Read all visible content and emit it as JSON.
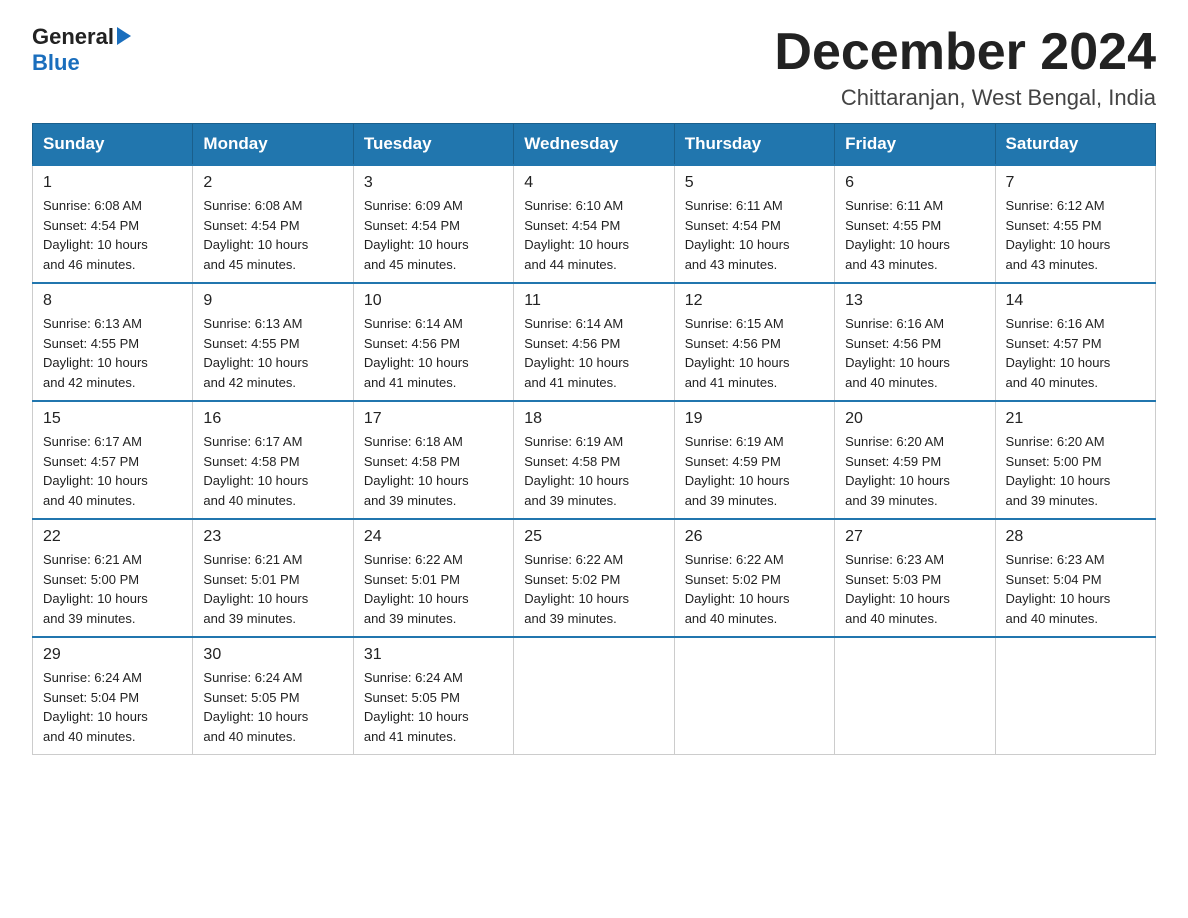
{
  "header": {
    "logo_general": "General",
    "logo_blue": "Blue",
    "title": "December 2024",
    "subtitle": "Chittaranjan, West Bengal, India"
  },
  "days_of_week": [
    "Sunday",
    "Monday",
    "Tuesday",
    "Wednesday",
    "Thursday",
    "Friday",
    "Saturday"
  ],
  "weeks": [
    [
      {
        "day": "1",
        "sunrise": "6:08 AM",
        "sunset": "4:54 PM",
        "daylight": "10 hours and 46 minutes."
      },
      {
        "day": "2",
        "sunrise": "6:08 AM",
        "sunset": "4:54 PM",
        "daylight": "10 hours and 45 minutes."
      },
      {
        "day": "3",
        "sunrise": "6:09 AM",
        "sunset": "4:54 PM",
        "daylight": "10 hours and 45 minutes."
      },
      {
        "day": "4",
        "sunrise": "6:10 AM",
        "sunset": "4:54 PM",
        "daylight": "10 hours and 44 minutes."
      },
      {
        "day": "5",
        "sunrise": "6:11 AM",
        "sunset": "4:54 PM",
        "daylight": "10 hours and 43 minutes."
      },
      {
        "day": "6",
        "sunrise": "6:11 AM",
        "sunset": "4:55 PM",
        "daylight": "10 hours and 43 minutes."
      },
      {
        "day": "7",
        "sunrise": "6:12 AM",
        "sunset": "4:55 PM",
        "daylight": "10 hours and 43 minutes."
      }
    ],
    [
      {
        "day": "8",
        "sunrise": "6:13 AM",
        "sunset": "4:55 PM",
        "daylight": "10 hours and 42 minutes."
      },
      {
        "day": "9",
        "sunrise": "6:13 AM",
        "sunset": "4:55 PM",
        "daylight": "10 hours and 42 minutes."
      },
      {
        "day": "10",
        "sunrise": "6:14 AM",
        "sunset": "4:56 PM",
        "daylight": "10 hours and 41 minutes."
      },
      {
        "day": "11",
        "sunrise": "6:14 AM",
        "sunset": "4:56 PM",
        "daylight": "10 hours and 41 minutes."
      },
      {
        "day": "12",
        "sunrise": "6:15 AM",
        "sunset": "4:56 PM",
        "daylight": "10 hours and 41 minutes."
      },
      {
        "day": "13",
        "sunrise": "6:16 AM",
        "sunset": "4:56 PM",
        "daylight": "10 hours and 40 minutes."
      },
      {
        "day": "14",
        "sunrise": "6:16 AM",
        "sunset": "4:57 PM",
        "daylight": "10 hours and 40 minutes."
      }
    ],
    [
      {
        "day": "15",
        "sunrise": "6:17 AM",
        "sunset": "4:57 PM",
        "daylight": "10 hours and 40 minutes."
      },
      {
        "day": "16",
        "sunrise": "6:17 AM",
        "sunset": "4:58 PM",
        "daylight": "10 hours and 40 minutes."
      },
      {
        "day": "17",
        "sunrise": "6:18 AM",
        "sunset": "4:58 PM",
        "daylight": "10 hours and 39 minutes."
      },
      {
        "day": "18",
        "sunrise": "6:19 AM",
        "sunset": "4:58 PM",
        "daylight": "10 hours and 39 minutes."
      },
      {
        "day": "19",
        "sunrise": "6:19 AM",
        "sunset": "4:59 PM",
        "daylight": "10 hours and 39 minutes."
      },
      {
        "day": "20",
        "sunrise": "6:20 AM",
        "sunset": "4:59 PM",
        "daylight": "10 hours and 39 minutes."
      },
      {
        "day": "21",
        "sunrise": "6:20 AM",
        "sunset": "5:00 PM",
        "daylight": "10 hours and 39 minutes."
      }
    ],
    [
      {
        "day": "22",
        "sunrise": "6:21 AM",
        "sunset": "5:00 PM",
        "daylight": "10 hours and 39 minutes."
      },
      {
        "day": "23",
        "sunrise": "6:21 AM",
        "sunset": "5:01 PM",
        "daylight": "10 hours and 39 minutes."
      },
      {
        "day": "24",
        "sunrise": "6:22 AM",
        "sunset": "5:01 PM",
        "daylight": "10 hours and 39 minutes."
      },
      {
        "day": "25",
        "sunrise": "6:22 AM",
        "sunset": "5:02 PM",
        "daylight": "10 hours and 39 minutes."
      },
      {
        "day": "26",
        "sunrise": "6:22 AM",
        "sunset": "5:02 PM",
        "daylight": "10 hours and 40 minutes."
      },
      {
        "day": "27",
        "sunrise": "6:23 AM",
        "sunset": "5:03 PM",
        "daylight": "10 hours and 40 minutes."
      },
      {
        "day": "28",
        "sunrise": "6:23 AM",
        "sunset": "5:04 PM",
        "daylight": "10 hours and 40 minutes."
      }
    ],
    [
      {
        "day": "29",
        "sunrise": "6:24 AM",
        "sunset": "5:04 PM",
        "daylight": "10 hours and 40 minutes."
      },
      {
        "day": "30",
        "sunrise": "6:24 AM",
        "sunset": "5:05 PM",
        "daylight": "10 hours and 40 minutes."
      },
      {
        "day": "31",
        "sunrise": "6:24 AM",
        "sunset": "5:05 PM",
        "daylight": "10 hours and 41 minutes."
      },
      null,
      null,
      null,
      null
    ]
  ],
  "labels": {
    "sunrise_prefix": "Sunrise: ",
    "sunset_prefix": "Sunset: ",
    "daylight_prefix": "Daylight: "
  }
}
